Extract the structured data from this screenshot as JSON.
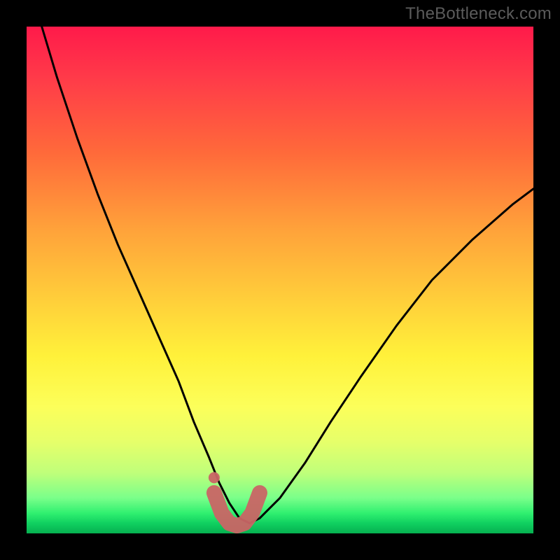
{
  "watermark": "TheBottleneck.com",
  "chart_data": {
    "type": "line",
    "title": "",
    "xlabel": "",
    "ylabel": "",
    "xlim": [
      0,
      100
    ],
    "ylim": [
      0,
      100
    ],
    "series": [
      {
        "name": "bottleneck-curve",
        "x": [
          3,
          6,
          10,
          14,
          18,
          22,
          26,
          30,
          33,
          36,
          38,
          40,
          42,
          44,
          46,
          50,
          55,
          60,
          66,
          73,
          80,
          88,
          96,
          100
        ],
        "values": [
          100,
          90,
          78,
          67,
          57,
          48,
          39,
          30,
          22,
          15,
          10,
          6,
          3,
          2,
          3,
          7,
          14,
          22,
          31,
          41,
          50,
          58,
          65,
          68
        ]
      },
      {
        "name": "highlight-band",
        "x": [
          37,
          38.5,
          40,
          41.5,
          43,
          44.5,
          46
        ],
        "values": [
          8,
          4,
          2,
          1.5,
          2,
          4,
          8
        ]
      }
    ],
    "annotations": [
      {
        "name": "highlight-dot",
        "x": 37,
        "y": 11
      }
    ],
    "gradient_stops": [
      {
        "pos": 0,
        "color": "#ff1a4a"
      },
      {
        "pos": 25,
        "color": "#ff6a3a"
      },
      {
        "pos": 55,
        "color": "#ffd23a"
      },
      {
        "pos": 75,
        "color": "#fcff5a"
      },
      {
        "pos": 93,
        "color": "#7aff8a"
      },
      {
        "pos": 100,
        "color": "#06b050"
      }
    ]
  }
}
